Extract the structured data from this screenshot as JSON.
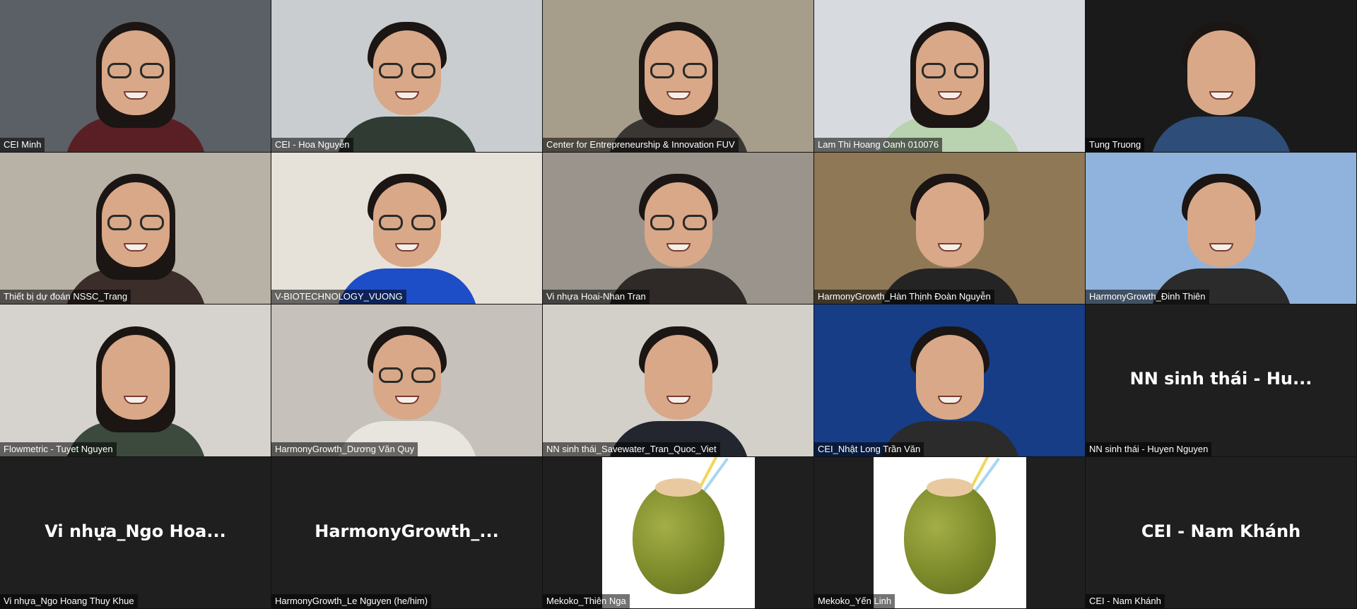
{
  "participants": [
    {
      "name": "CEI Minh",
      "video": true,
      "bg": "#5b5f66",
      "hair": "long",
      "glasses": true,
      "shirt": "#5a1f24"
    },
    {
      "name": "CEI - Hoa Nguyễn",
      "video": true,
      "bg": "#c9cdd0",
      "hair": "short",
      "glasses": true,
      "shirt": "#2f3b33"
    },
    {
      "name": "Center for Entrepreneurship & Innovation FUV",
      "video": true,
      "bg": "#a79d8b",
      "hair": "long",
      "glasses": true,
      "shirt": "#3a3634"
    },
    {
      "name": "Lam Thi Hoang Oanh 010076",
      "video": true,
      "bg": "#d7dbe0",
      "hair": "long",
      "glasses": true,
      "shirt": "#b9d2b0"
    },
    {
      "name": "Tung Truong",
      "video": true,
      "bg": "#1a1a1a",
      "hair": "short",
      "glasses": false,
      "shirt": "#2e4d78"
    },
    {
      "name": "Thiết bị dự đoán NSSC_Trang",
      "video": true,
      "bg": "#b8b1a6",
      "hair": "long",
      "glasses": true,
      "shirt": "#3b2d2a"
    },
    {
      "name": "V-BIOTECHNOLOGY_VUONG",
      "video": true,
      "bg": "#e6e2da",
      "hair": "short",
      "glasses": true,
      "shirt": "#1e4ec7"
    },
    {
      "name": "Vi nhựa Hoai-Nhan Tran",
      "video": true,
      "bg": "#9a948d",
      "hair": "short",
      "glasses": true,
      "shirt": "#2f2a27"
    },
    {
      "name": "HarmonyGrowth_Hàn Thịnh Đoàn Nguyễn",
      "video": true,
      "bg": "#8f7856",
      "hair": "short",
      "glasses": false,
      "shirt": "#242424"
    },
    {
      "name": "HarmonyGrowth_Đinh Thiên",
      "video": true,
      "bg": "#8fb3dc",
      "hair": "short",
      "glasses": false,
      "shirt": "#2b2b2b"
    },
    {
      "name": "Flowmetric - Tuyet Nguyen",
      "video": true,
      "bg": "#d6d3cf",
      "hair": "long",
      "glasses": false,
      "shirt": "#3b4a3d"
    },
    {
      "name": "HarmonyGrowth_Dương Văn Quy",
      "video": true,
      "bg": "#c6c1ba",
      "hair": "short",
      "glasses": true,
      "shirt": "#e8e4de"
    },
    {
      "name": "NN sinh thái_Savewater_Tran_Quoc_Viet",
      "video": true,
      "bg": "#d3d0ca",
      "hair": "short",
      "glasses": false,
      "shirt": "#23262e"
    },
    {
      "name": "CEI_Nhật Long Trần Văn",
      "video": true,
      "bg": "#163d86",
      "hair": "short",
      "glasses": false,
      "shirt": "#2b2b2b"
    },
    {
      "name": "NN sinh thái - Huyen Nguyen",
      "video": false,
      "big": "NN sinh thái - Hu..."
    },
    {
      "name": "Vi nhựa_Ngo Hoang Thuy Khue",
      "video": false,
      "big": "Vi nhựa_Ngo Hoa..."
    },
    {
      "name": "HarmonyGrowth_Le Nguyen (he/him)",
      "video": false,
      "big": "HarmonyGrowth_..."
    },
    {
      "name": "Mekoko_Thiên Nga",
      "video": false,
      "avatar": "coconut"
    },
    {
      "name": "Mekoko_Yến Linh",
      "video": false,
      "avatar": "coconut"
    },
    {
      "name": "CEI - Nam Khánh",
      "video": false,
      "big": "CEI - Nam Khánh"
    }
  ]
}
